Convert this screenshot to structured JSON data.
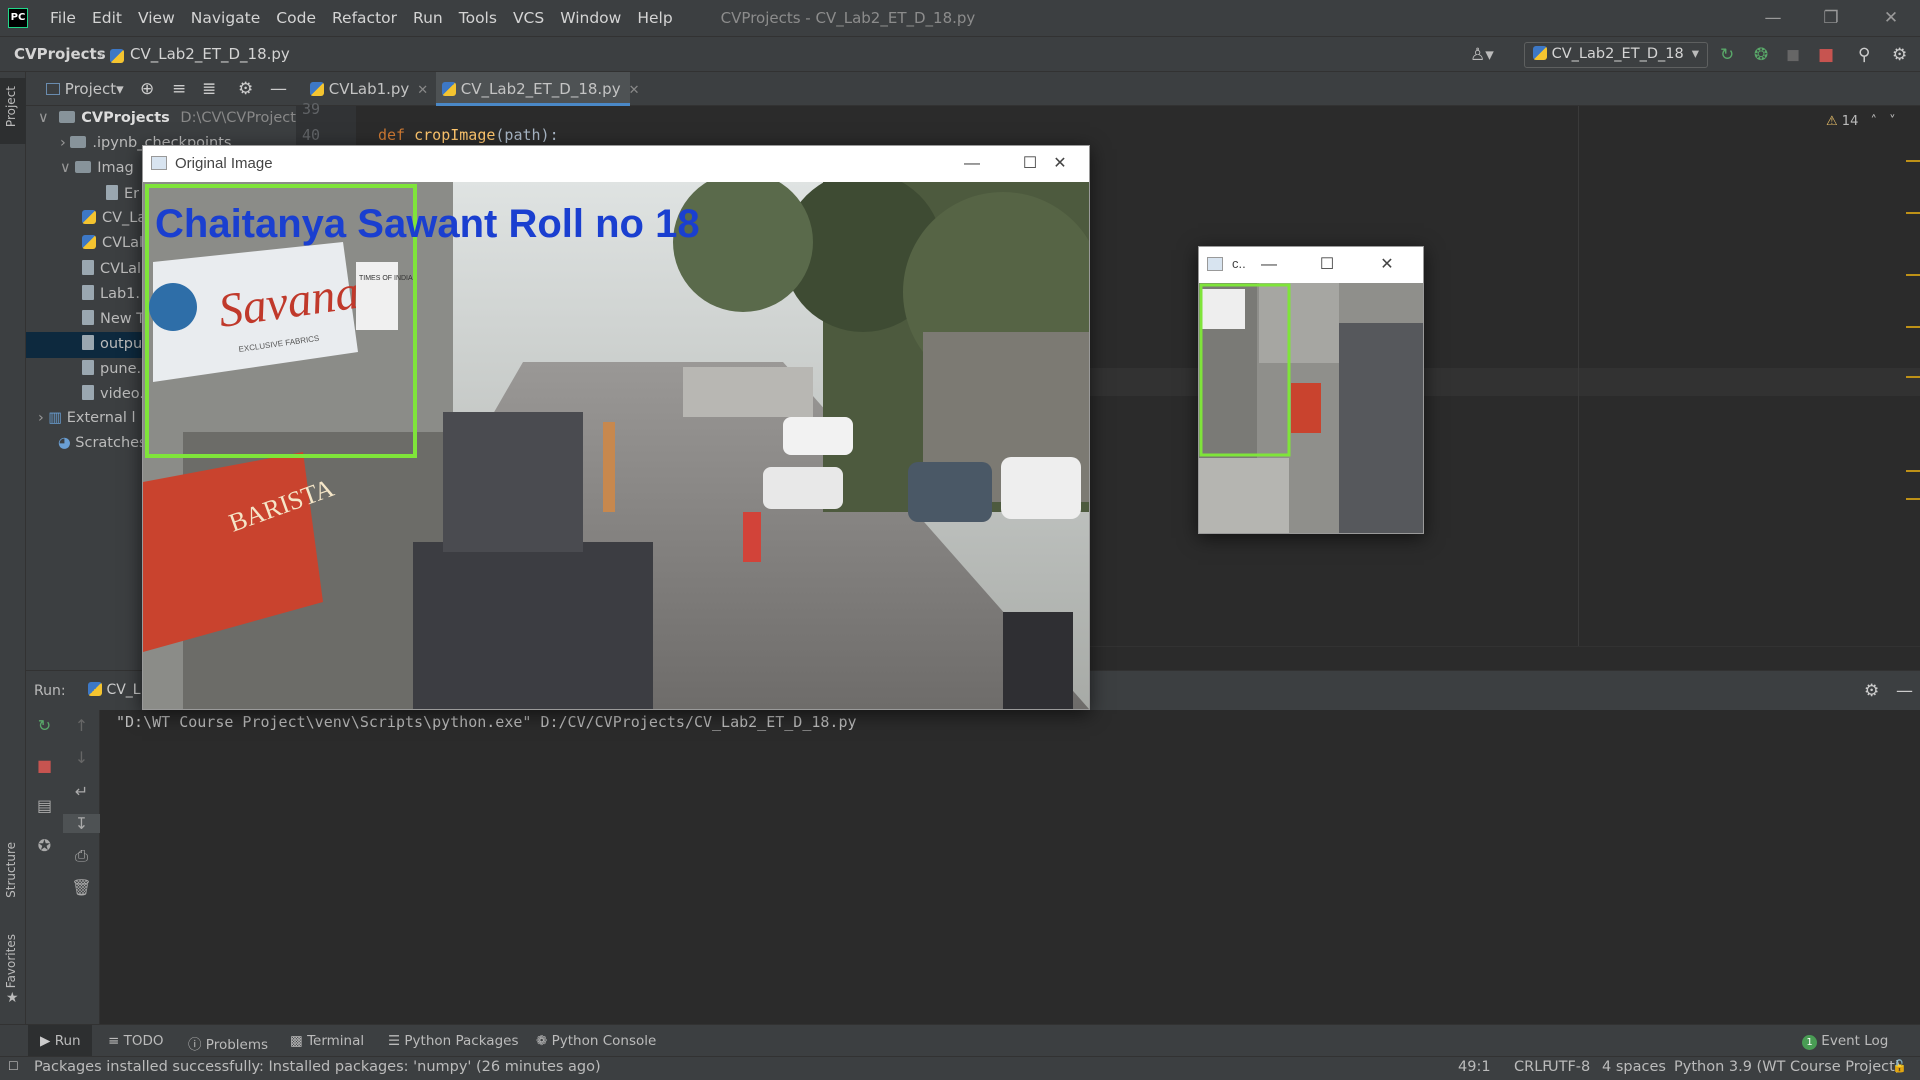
{
  "ide": {
    "logo": "PC",
    "menu": [
      "File",
      "Edit",
      "View",
      "Navigate",
      "Code",
      "Refactor",
      "Run",
      "Tools",
      "VCS",
      "Window",
      "Help"
    ],
    "window_title": "CVProjects - CV_Lab2_ET_D_18.py",
    "breadcrumb": {
      "project": "CVProjects",
      "file": "CV_Lab2_ET_D_18.py"
    },
    "run_config": "CV_Lab2_ET_D_18",
    "accent": "#4a88c7"
  },
  "left_strip": {
    "project": "Project",
    "structure": "Structure",
    "favorites": "Favorites"
  },
  "tabs": {
    "project_label": "Project",
    "files": [
      "CVLab1.py",
      "CV_Lab2_ET_D_18.py"
    ]
  },
  "project_tree": {
    "root": "CVProjects",
    "root_path": "D:\\CV\\CVProjects",
    "items": [
      ".ipynb_checkpoints",
      "Imag",
      "Er",
      "CV_La",
      "CVLal",
      "CVLal",
      "Lab1.",
      "New T",
      "outpu",
      "pune.",
      "video.",
      "External l",
      "Scratches"
    ]
  },
  "editor": {
    "line_numbers": [
      "39",
      "40"
    ],
    "code_keyword": "def",
    "code_func": "cropImage",
    "code_rest": "(path):",
    "warnings": "14"
  },
  "run_panel": {
    "label": "Run:",
    "config_short": "CV_L",
    "command": "\"D:\\WT Course Project\\venv\\Scripts\\python.exe\" D:/CV/CVProjects/CV_Lab2_ET_D_18.py"
  },
  "bottom_tabs": [
    "Run",
    "TODO",
    "Problems",
    "Terminal",
    "Python Packages",
    "Python Console"
  ],
  "event_log": {
    "badge": "1",
    "label": "Event Log"
  },
  "status": {
    "message": "Packages installed successfully: Installed packages: 'numpy' (26 minutes ago)",
    "position": "49:1",
    "line_sep": "CRLF",
    "encoding": "UTF-8",
    "indent": "4 spaces",
    "interpreter": "Python 3.9 (WT Course Project)"
  },
  "original_window": {
    "title": "Original Image",
    "overlay_text": "Chaitanya Sawant Roll no 18",
    "overlay_color": "#1a3fd0",
    "rect_color": "#7fe43a",
    "sign_text": "Savana",
    "sign_sub": "EXCLUSIVE FABRICS",
    "barista": "BARISTA",
    "times": "TIMES OF INDIA"
  },
  "crop_window": {
    "title": "c.."
  }
}
